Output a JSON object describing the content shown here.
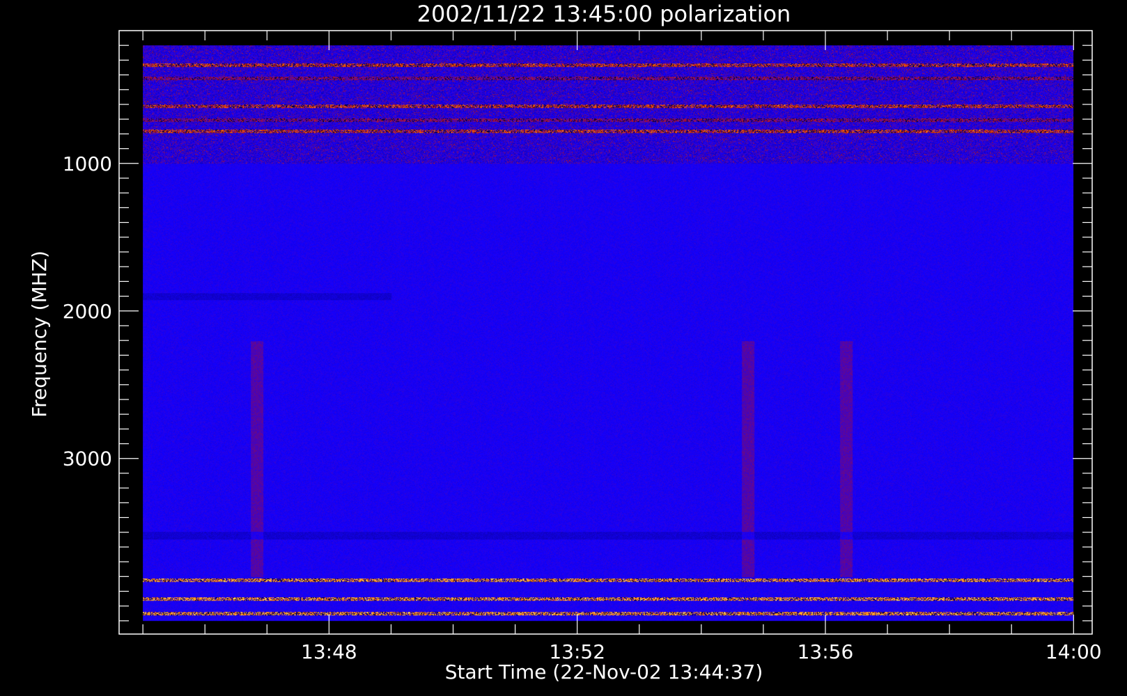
{
  "chart_data": {
    "type": "heatmap",
    "title": "2002/11/22 13:45:00 polarization",
    "xlabel": "Start Time (22-Nov-02 13:44:37)",
    "ylabel": "Frequency (MHZ)",
    "x_ticks": [
      "13:48",
      "13:52",
      "13:56",
      "14:00"
    ],
    "y_ticks": [
      "1000",
      "2000",
      "3000"
    ],
    "xlim": [
      "13:44:37",
      "14:00:18"
    ],
    "ylim": [
      100,
      4190
    ],
    "y_axis_inverted": true,
    "data_extent": {
      "x": [
        "13:45:00",
        "14:00:00"
      ],
      "y": [
        200,
        4100
      ]
    },
    "colormap": [
      "#000000",
      "#1400ff",
      "#c01010",
      "#ff7a00",
      "#ffe060"
    ],
    "background_color": "#1400ff",
    "features": [
      {
        "type": "rfi-band",
        "freq_mhz": 330,
        "intensity": "high"
      },
      {
        "type": "rfi-band",
        "freq_mhz": 420,
        "intensity": "medium"
      },
      {
        "type": "rfi-band",
        "freq_mhz": 610,
        "intensity": "high"
      },
      {
        "type": "rfi-band",
        "freq_mhz": 705,
        "intensity": "medium"
      },
      {
        "type": "rfi-band",
        "freq_mhz": 780,
        "intensity": "high"
      },
      {
        "type": "rfi-band",
        "freq_mhz": 3820,
        "intensity": "very-high"
      },
      {
        "type": "rfi-band",
        "freq_mhz": 3950,
        "intensity": "very-high"
      },
      {
        "type": "rfi-band",
        "freq_mhz": 4050,
        "intensity": "very-high"
      },
      {
        "type": "faint-band",
        "freq_mhz": 1900,
        "time_range": [
          "13:45:00",
          "13:49:00"
        ]
      },
      {
        "type": "faint-band",
        "freq_mhz": 3520,
        "time_range": [
          "13:45:00",
          "14:00:00"
        ]
      },
      {
        "type": "faint-streak",
        "time": "13:46:50"
      },
      {
        "type": "faint-streak",
        "time": "13:54:45"
      },
      {
        "type": "faint-streak",
        "time": "13:56:20"
      }
    ]
  }
}
